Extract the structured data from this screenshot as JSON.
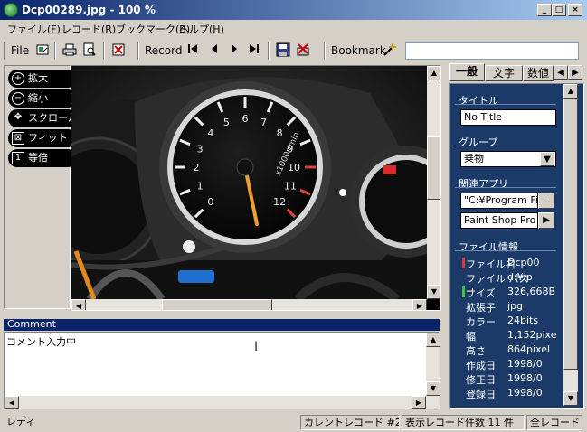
{
  "window": {
    "title": "Dcp00289.jpg - 100 %",
    "minimize": "_",
    "maximize": "□",
    "close": "×"
  },
  "menu": [
    "ファイル(F)",
    "レコード(R)",
    "ブックマーク(B)",
    "ヘルプ(H)"
  ],
  "toolbar": {
    "file_label": "File",
    "record_label": "Record",
    "bookmark_label": "Bookmark",
    "bookmark_value": ""
  },
  "zoom_tools": [
    {
      "label": "拡大",
      "icon": "+"
    },
    {
      "label": "縮小",
      "icon": "−"
    },
    {
      "label": "スクロール",
      "icon": "✥"
    },
    {
      "label": "フィット",
      "icon": "⊠"
    },
    {
      "label": "等倍",
      "icon": "1"
    }
  ],
  "gauge": {
    "scale_label": "x1000r/min",
    "ticks": [
      "0",
      "1",
      "2",
      "3",
      "4",
      "5",
      "6",
      "7",
      "8",
      "9",
      "10",
      "11",
      "12"
    ]
  },
  "comment": {
    "header": "Comment",
    "text": "コメント入力中"
  },
  "tabs": [
    "一般",
    "文字",
    "数値"
  ],
  "info": {
    "title_label": "タイトル",
    "title_value": "No Title",
    "group_label": "グループ",
    "group_value": "乗物",
    "app_label": "関連アプリ",
    "app_path": "\"C:¥Program Fi",
    "app_name": "Paint Shop Pro",
    "file_info_label": "ファイル情報",
    "rows": [
      {
        "key": "ファイル名",
        "value": "Dcp00",
        "mark": "#d43c3c"
      },
      {
        "key": "ファイル パス",
        "value": "d:¥ip",
        "mark": ""
      },
      {
        "key": "サイズ",
        "value": "326,668B",
        "mark": "#3cc43c"
      },
      {
        "key": "拡張子",
        "value": "jpg",
        "mark": ""
      },
      {
        "key": "カラー",
        "value": "24bits",
        "mark": ""
      },
      {
        "key": "幅",
        "value": "1,152pixel",
        "mark": ""
      },
      {
        "key": "高さ",
        "value": "864pixel",
        "mark": ""
      },
      {
        "key": "作成日",
        "value": "1998/0",
        "mark": ""
      },
      {
        "key": "修正日",
        "value": "1998/0",
        "mark": ""
      },
      {
        "key": "登録日",
        "value": "1998/0",
        "mark": ""
      }
    ]
  },
  "status": {
    "ready": "レディ",
    "current_record": "カレントレコード  #2",
    "display_count": "表示レコード件数  11 件",
    "all_records": "全レコード"
  }
}
